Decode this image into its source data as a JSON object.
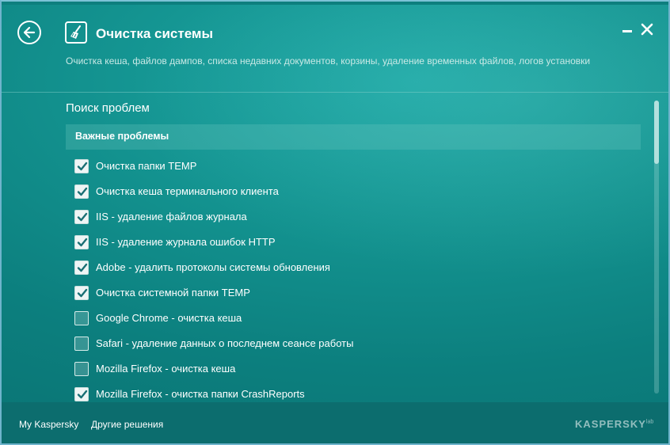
{
  "header": {
    "title": "Очистка системы",
    "subtitle": "Очистка кеша, файлов дампов, списка недавних документов, корзины, удаление временных файлов, логов установки",
    "icons": {
      "back": "back-arrow-icon",
      "app": "broom-icon",
      "minimize": "minimize-icon",
      "close": "close-icon"
    }
  },
  "main": {
    "section_title": "Поиск проблем",
    "group_title": "Важные проблемы",
    "items": [
      {
        "label": "Очистка папки TEMP",
        "checked": true
      },
      {
        "label": "Очистка кеша терминального клиента",
        "checked": true
      },
      {
        "label": "IIS - удаление файлов журнала",
        "checked": true
      },
      {
        "label": "IIS - удаление журнала ошибок HTTP",
        "checked": true
      },
      {
        "label": "Adobe - удалить протоколы системы обновления",
        "checked": true
      },
      {
        "label": "Очистка системной папки TEMP",
        "checked": true
      },
      {
        "label": "Google Chrome - очистка кеша",
        "checked": false
      },
      {
        "label": "Safari - удаление данных о последнем сеансе работы",
        "checked": false
      },
      {
        "label": "Mozilla Firefox - очистка кеша",
        "checked": false
      },
      {
        "label": "Mozilla Firefox - очистка папки CrashReports",
        "checked": true
      }
    ]
  },
  "footer": {
    "link_my_kaspersky": "My Kaspersky",
    "link_other_solutions": "Другие решения",
    "logo_text": "KASPERSKY",
    "logo_suffix": "lab"
  },
  "colors": {
    "window_bg": "#13928f",
    "footer_bg": "#0c6d6e",
    "text": "#ffffff",
    "subtitle_text": "#c9e9e6"
  }
}
